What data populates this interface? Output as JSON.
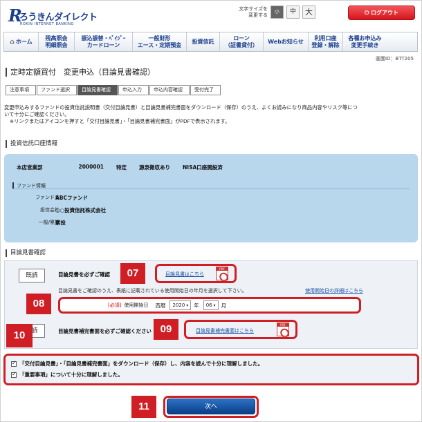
{
  "header": {
    "logo_mark": "R",
    "logo_name": "ろうきんダイレクト",
    "logo_sub": "ROKIN INTERNET BANKING",
    "font_size_label": "文字サイズを\n変更する",
    "font_small": "小",
    "font_mid": "中",
    "font_large": "大",
    "logout": "ログアウト"
  },
  "nav": [
    {
      "label": "ホーム",
      "icon": "home-icon"
    },
    {
      "label": "残高照会\n明細照会"
    },
    {
      "label": "振込振替・ﾍﾟｲｼﾞｰ\nカードローン"
    },
    {
      "label": "一般財形\nエース・定期預金"
    },
    {
      "label": "投資信託"
    },
    {
      "label": "ローン\n（証書貸付）"
    },
    {
      "label": "Webお知らせ"
    },
    {
      "label": "利用口座\n登録・解除"
    },
    {
      "label": "各種お申込み\n変更手続き"
    }
  ],
  "screen_id": "画面ID：BTT205",
  "page_title": "定時定額買付　変更申込（目論見書確認）",
  "steps": [
    {
      "label": "注意事項",
      "active": false
    },
    {
      "label": "ファンド選択",
      "active": false
    },
    {
      "label": "目論見書確認",
      "active": true
    },
    {
      "label": "申込入力",
      "active": false
    },
    {
      "label": "申込内容確認",
      "active": false
    },
    {
      "label": "受付完了",
      "active": false
    }
  ],
  "intro": {
    "line1": "変更申込みするファンドの投資信託説明書（交付目論見書）と目論見書補完書面をダウンロード（保存）のうえ、よくお読みになり商品内容やリスク等につ",
    "line2": "いて十分にご確認ください。",
    "line3": "※リンクまたはアイコンを押すと「交付目論見書」・「目論見書補完書面」がPDFで表示されます。"
  },
  "account": {
    "section_title": "投資信託口座情報",
    "branch": "本店営業部",
    "number": "2000001",
    "type": "特定",
    "withholding": "源泉徴収あり",
    "nisa": "NISA口座開設済",
    "fund_header": "ファンド情報",
    "fund_name_label": "ファンド名",
    "fund_name": "ABCファンド",
    "company_label": "投信会社",
    "company": "○○投資信託株式会社",
    "category_label": "一般/累投",
    "category": "累投"
  },
  "prospectus": {
    "section_title": "目論見書確認",
    "read_label": "既読",
    "must_check": "目論見書を必ずご確認",
    "link1": "目論見書はこちら",
    "sub_text": "目論見書をご確認のうえ、表紙に記載されている使用開始日の年月を選択して下さい。",
    "detail_link": "使用開始日の詳細はこちら",
    "required": "[必須]",
    "start_label": "使用開始日",
    "era": "西暦",
    "year": "2020",
    "year_unit": "年",
    "month": "06",
    "month_unit": "月",
    "read_label2": "既読",
    "must_check2": "目論見書補完書面を必ずご確認ください",
    "link2": "目論見書補完書面はこちら"
  },
  "checks": {
    "check1": "「交付目論見書」・「目論見書補完書面」をダウンロード（保存）し、内容を読んで十分に理解しました。",
    "check2": "「重要事項」について十分に理解しました。"
  },
  "next_button": "次へ",
  "callouts": {
    "c07": "07",
    "c08": "08",
    "c09": "09",
    "c10": "10",
    "c11": "11"
  },
  "colors": {
    "brand": "#1a3e8c",
    "logout": "#d6141b",
    "callout": "#d01e25",
    "panel": "#b8d6ec",
    "next": "#0a3f87"
  }
}
